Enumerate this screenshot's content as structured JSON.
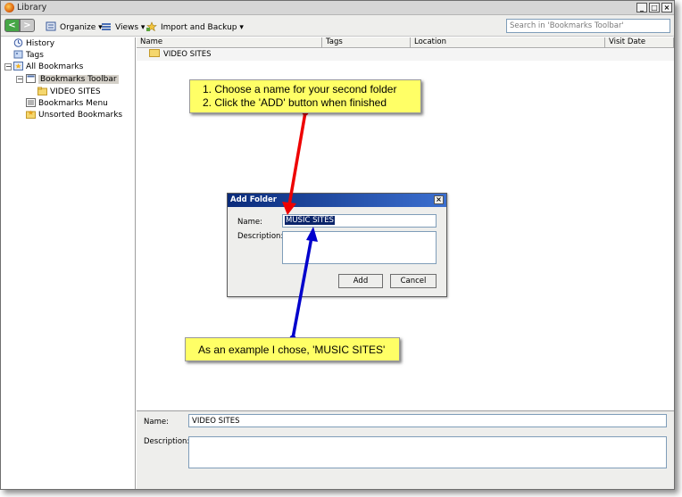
{
  "window": {
    "title": "Library",
    "controls": [
      "_",
      "□",
      "×"
    ]
  },
  "toolbar": {
    "back": "<",
    "forward": ">",
    "organize": "Organize ▾",
    "views": "Views ▾",
    "import_backup": "Import and Backup ▾",
    "search_placeholder": "Search in 'Bookmarks Toolbar'"
  },
  "sidebar": {
    "items": [
      {
        "label": "History",
        "icon": "clock-icon"
      },
      {
        "label": "Tags",
        "icon": "tag-icon"
      },
      {
        "label": "All Bookmarks",
        "icon": "star-icon"
      },
      {
        "label": "Bookmarks Toolbar",
        "icon": "toolbar-icon"
      },
      {
        "label": "VIDEO SITES",
        "icon": "folder-icon"
      },
      {
        "label": "Bookmarks Menu",
        "icon": "menu-icon"
      },
      {
        "label": "Unsorted Bookmarks",
        "icon": "unsorted-icon"
      }
    ]
  },
  "table": {
    "columns": [
      "Name",
      "Tags",
      "Location",
      "Visit Date"
    ],
    "rows": [
      {
        "name": "VIDEO SITES"
      }
    ]
  },
  "details": {
    "name_label": "Name:",
    "name_value": "VIDEO SITES",
    "description_label": "Description:",
    "description_value": ""
  },
  "dialog": {
    "title": "Add Folder",
    "close": "×",
    "name_label": "Name:",
    "name_value": "MUSIC SITES",
    "description_label": "Description:",
    "description_value": "",
    "add_button": "Add",
    "cancel_button": "Cancel"
  },
  "callouts": {
    "top": [
      "1.  Choose a name for your second folder",
      "2.  Click the 'ADD' button when finished"
    ],
    "bottom": "As an example I chose, 'MUSIC SITES'"
  },
  "colors": {
    "callout_bg": "#ffff66",
    "red_arrow": "#ee0000",
    "blue_arrow": "#0000cc",
    "dialog_title": "#0a2b7a",
    "selection": "#0a246a"
  }
}
